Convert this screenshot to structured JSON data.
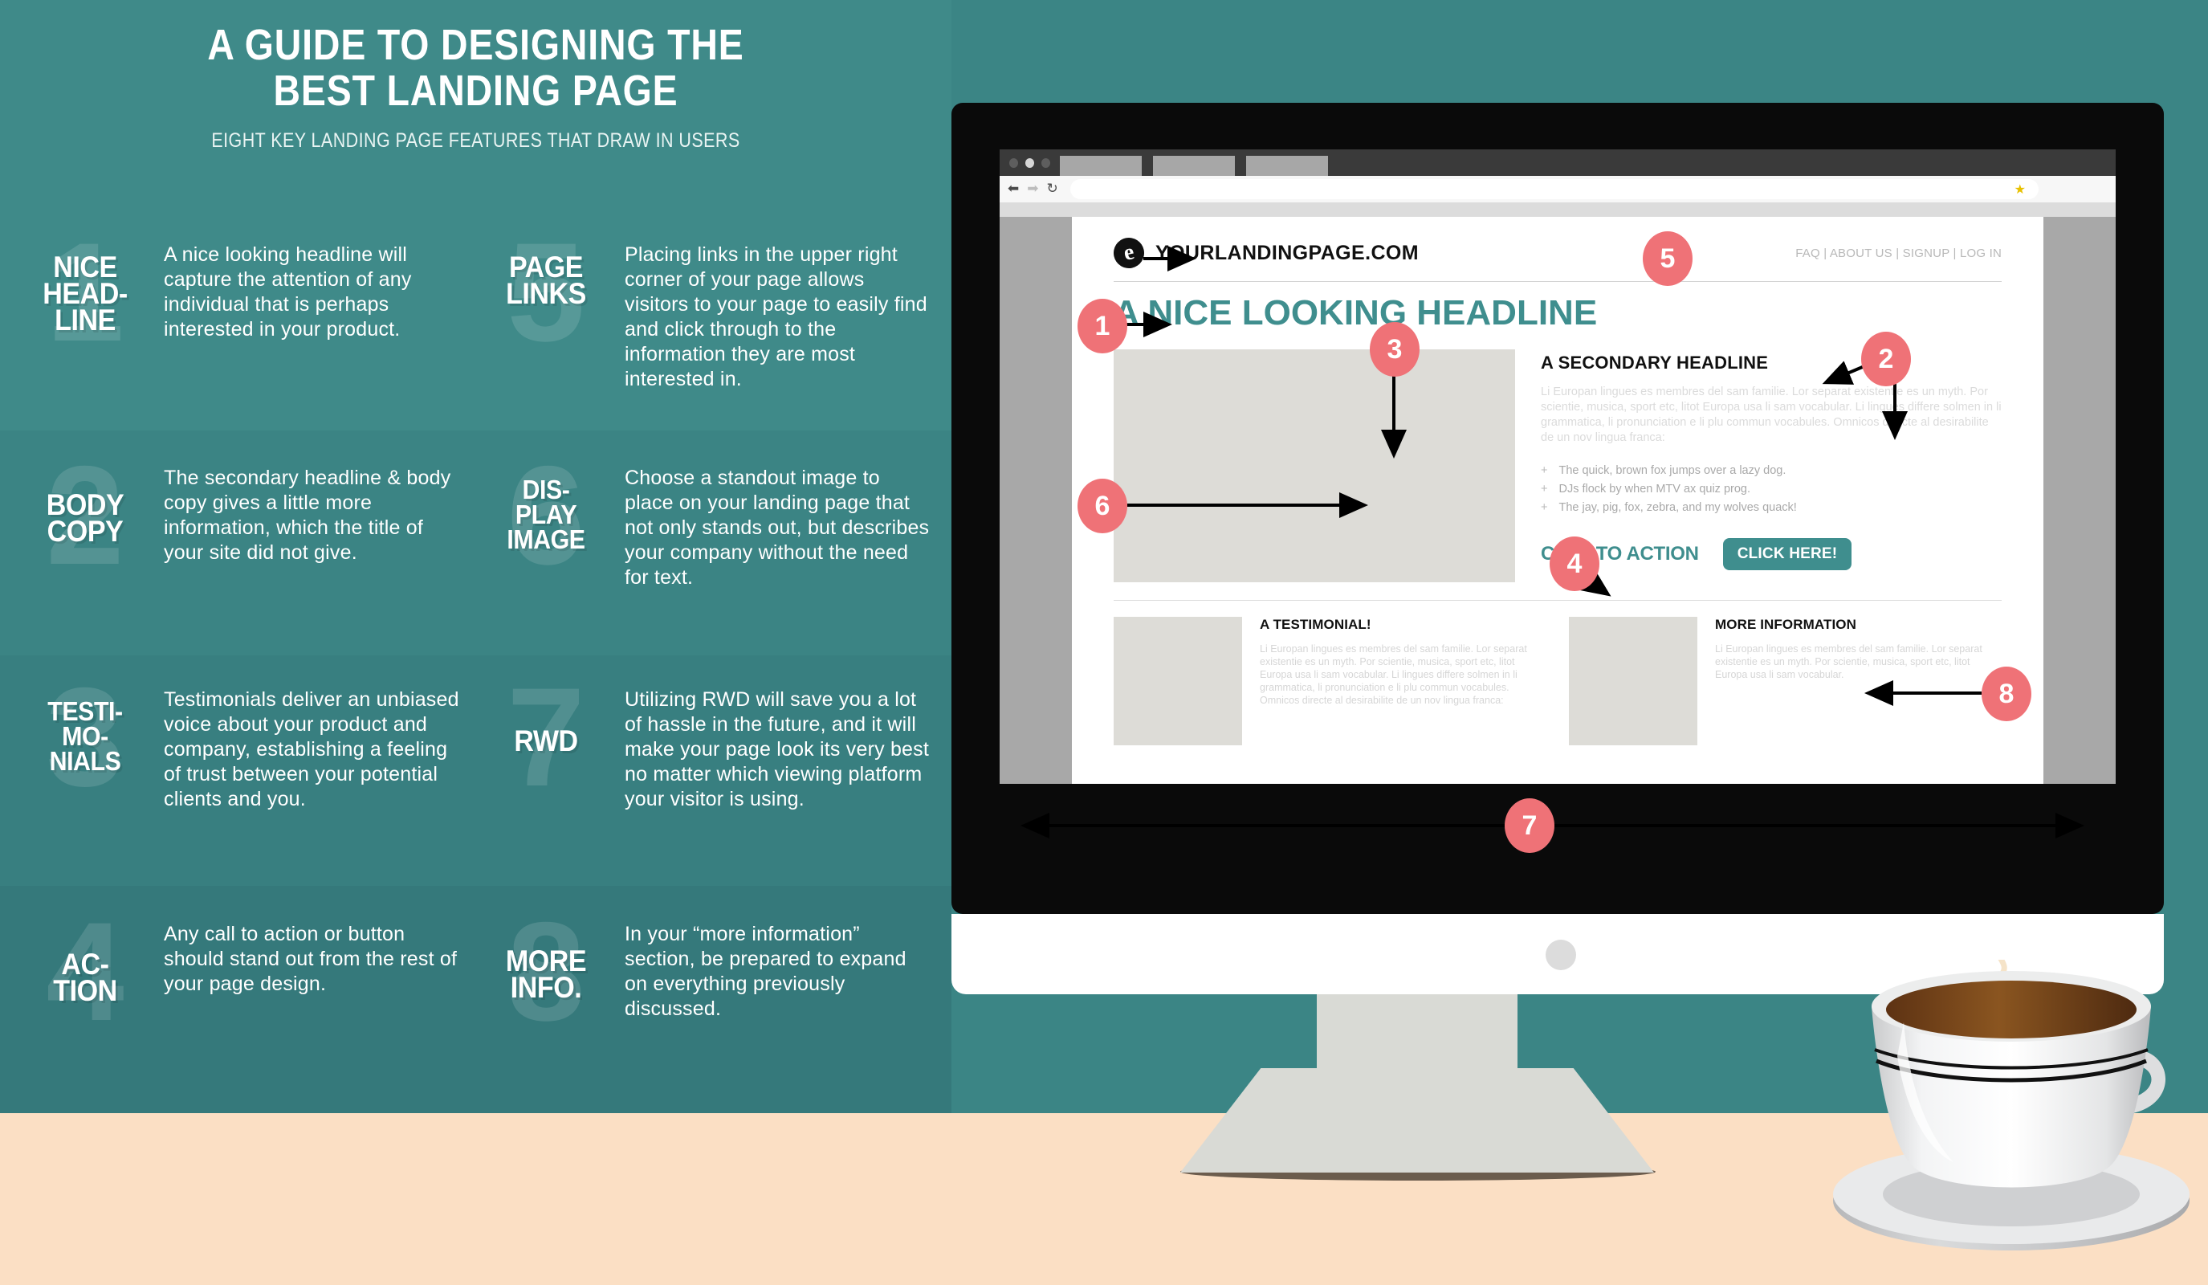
{
  "hero": {
    "title_line1": "A GUIDE TO DESIGNING THE",
    "title_line2": "BEST LANDING PAGE",
    "subtitle": "EIGHT KEY LANDING PAGE FEATURES THAT DRAW IN USERS"
  },
  "colors": {
    "teal": "#3b8585",
    "teal_accent": "#3f8e8e",
    "badge_red": "#ef7277",
    "desk_peach": "#fbdfc4",
    "bezel_black": "#0a0a0a"
  },
  "features": [
    {
      "number": "1",
      "keyword_lines": [
        "NICE",
        "HEAD-",
        "LINE"
      ],
      "description": "A nice looking headline will capture the attention of any individual that is perhaps interested in your product."
    },
    {
      "number": "5",
      "keyword_lines": [
        "PAGE",
        "LINKS"
      ],
      "description": "Placing links in the upper right corner of your page allows visitors to your page to easily find and click through to the information they are most interested in."
    },
    {
      "number": "2",
      "keyword_lines": [
        "BODY",
        "COPY"
      ],
      "description": "The secondary headline & body copy gives a little more information, which the title of your site did not give."
    },
    {
      "number": "6",
      "keyword_lines": [
        "DIS-",
        "PLAY",
        "IMAGE"
      ],
      "description": "Choose a standout image to place on your landing page that not only stands out, but describes your company without the need for text."
    },
    {
      "number": "3",
      "keyword_lines": [
        "TESTI-",
        "MO-",
        "NIALS"
      ],
      "description": "Testimonials deliver an unbiased voice about your product and company, establishing a feeling of trust between your potential clients and you."
    },
    {
      "number": "7",
      "keyword_lines": [
        "RWD"
      ],
      "description": "Utilizing RWD will save you a lot of hassle in the future, and it will make your page look its very best no matter which viewing platform your visitor is using."
    },
    {
      "number": "4",
      "keyword_lines": [
        "AC-",
        "TION"
      ],
      "description": "Any call to action or button should stand out from the rest of your page design."
    },
    {
      "number": "8",
      "keyword_lines": [
        "MORE",
        "INFO."
      ],
      "description": "In your “more information” section, be prepared to expand on everything previously discussed."
    }
  ],
  "browser": {
    "tab_count": 3,
    "back_icon": "back-arrow-icon",
    "forward_icon": "forward-arrow-icon",
    "reload_icon": "reload-icon",
    "bookmark_icon": "star-icon",
    "url_value": "",
    "url_placeholder": ""
  },
  "landing_page": {
    "logo_letter": "e",
    "brand_name": "YOURLANDINGPAGE.COM",
    "nav_links": "FAQ | ABOUT US | SIGNUP | LOG IN",
    "main_headline": "A NICE LOOKING HEADLINE",
    "secondary_headline": "A SECONDARY HEADLINE",
    "body_copy": "Li Europan lingues es membres del sam familie. Lor separat existentie es un myth. Por scientie, musica, sport etc, litot Europa usa li sam vocabular. Li lingues differe solmen in li grammatica, li pronunciation e li plu commun vocabules. Omnicos directe al desirabilite de un nov lingua franca:",
    "bullets": [
      "The quick, brown fox jumps over a lazy dog.",
      "DJs flock by when MTV ax quiz prog.",
      "The jay, pig, fox, zebra, and my wolves quack!"
    ],
    "bullet_marker": "+",
    "cta_text": "CALL TO ACTION",
    "cta_button": "CLICK HERE!",
    "testimonial": {
      "heading": "A TESTIMONIAL!",
      "body": "Li Europan lingues es membres del sam familie. Lor separat existentie es un myth. Por scientie, musica, sport etc, litot Europa usa li sam vocabular. Li lingues differe solmen in li grammatica, li pronunciation e li plu commun vocabules. Omnicos directe al desirabilite de un nov lingua franca:"
    },
    "more_info": {
      "heading": "MORE INFORMATION",
      "body": "Li Europan lingues es membres del sam familie. Lor separat existentie es un myth. Por scientie, musica, sport etc, litot Europa usa li sam vocabular."
    }
  },
  "callouts": [
    {
      "number": "1",
      "target": "main-headline"
    },
    {
      "number": "2",
      "target": "secondary-headline"
    },
    {
      "number": "3",
      "target": "testimonial-section"
    },
    {
      "number": "4",
      "target": "call-to-action"
    },
    {
      "number": "5",
      "target": "page-nav-links"
    },
    {
      "number": "6",
      "target": "display-image"
    },
    {
      "number": "7",
      "target": "responsive-width"
    },
    {
      "number": "8",
      "target": "more-information"
    }
  ],
  "decor": {
    "coffee_cup": "coffee-cup-illustration",
    "steam": "steam-icon"
  }
}
